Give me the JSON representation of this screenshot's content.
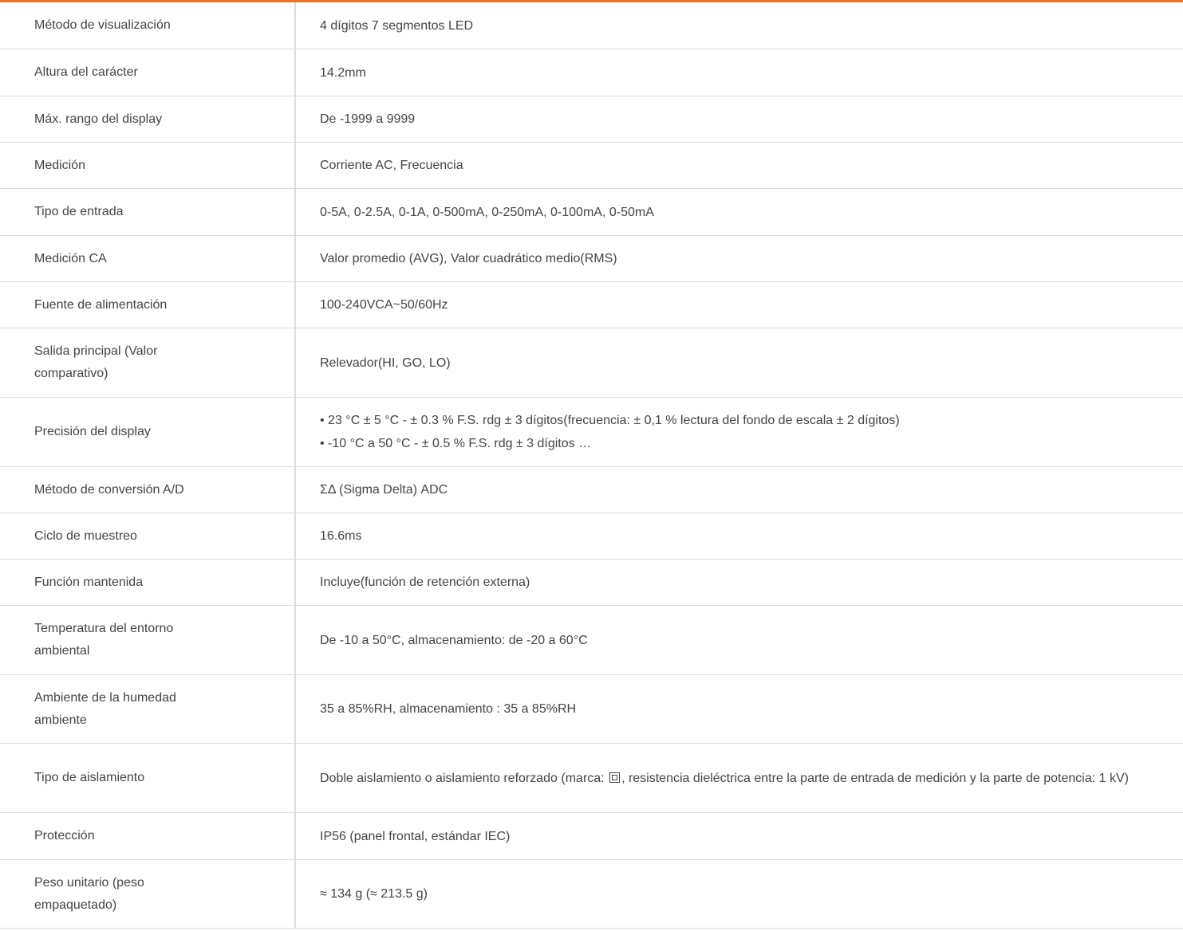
{
  "colors": {
    "accent": "#e8742a",
    "text": "#444444",
    "border": "#dcdcdc"
  },
  "specs": [
    {
      "label": "Método de visualización",
      "value": "4 dígitos 7 segmentos LED"
    },
    {
      "label": "Altura del carácter",
      "value": "14.2mm"
    },
    {
      "label": "Máx. rango del display",
      "value": "De -1999 a 9999"
    },
    {
      "label": "Medición",
      "value": "Corriente AC, Frecuencia"
    },
    {
      "label": "Tipo de entrada",
      "value": "0-5A, 0-2.5A, 0-1A, 0-500mA, 0-250mA, 0-100mA, 0-50mA"
    },
    {
      "label": "Medición CA",
      "value": "Valor promedio (AVG), Valor cuadrático medio(RMS)"
    },
    {
      "label": "Fuente de alimentación",
      "value": "100-240VCA~50/60Hz"
    },
    {
      "label": "Salida principal (Valor comparativo)",
      "value": "Relevador(HI, GO, LO)"
    },
    {
      "label": "Precisión del display",
      "value_lines": [
        "• 23 °C ± 5 °C - ± 0.3 % F.S. rdg ± 3 dígitos(frecuencia: ± 0,1 % lectura del fondo de escala ± 2 dígitos)",
        "• -10 °C a 50 °C - ± 0.5 % F.S. rdg ± 3 dígitos …"
      ]
    },
    {
      "label": "Método de conversión A/D",
      "value": "ΣΔ (Sigma Delta) ADC"
    },
    {
      "label": "Ciclo de muestreo",
      "value": "16.6ms"
    },
    {
      "label": "Función mantenida",
      "value": "Incluye(función de retención externa)"
    },
    {
      "label": "Temperatura del entorno ambiental",
      "value": "De -10 a 50°C, almacenamiento: de -20 a 60°C"
    },
    {
      "label": "Ambiente de la humedad ambiente",
      "value": "35 a 85%RH, almacenamiento : 35 a 85%RH"
    },
    {
      "label": "Tipo de aislamiento",
      "value_before_icon": "Doble aislamiento o aislamiento reforzado (marca: ",
      "icon": "double-insulation-icon",
      "value_after_icon": ", resistencia dieléctrica entre la parte de entrada de medición y la parte de potencia: 1 kV)"
    },
    {
      "label": "Protección",
      "value": "IP56 (panel frontal, estándar IEC)"
    },
    {
      "label": "Peso unitario (peso empaquetado)",
      "value": "≈ 134 g (≈ 213.5 g)"
    }
  ]
}
